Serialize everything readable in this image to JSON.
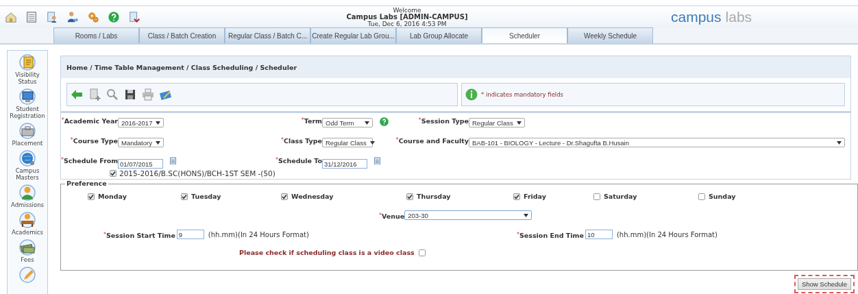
{
  "header": {
    "welcome": "Welcome",
    "user": "Campus Labs [ADMIN-CAMPUS]",
    "datetime": "Tue, Dec 6, 2016 4:53 PM",
    "logo_primary": "campus",
    "logo_secondary": "labs"
  },
  "tabs": [
    {
      "label": "Rooms / Labs",
      "selected": false
    },
    {
      "label": "Class / Batch Creation",
      "selected": false
    },
    {
      "label": "Regular Class / Batch C...",
      "selected": false
    },
    {
      "label": "Create Regular Lab Grou...",
      "selected": false
    },
    {
      "label": "Lab Group Allocate",
      "selected": false
    },
    {
      "label": "Scheduler",
      "selected": true
    },
    {
      "label": "Weekly Schedule",
      "selected": false
    }
  ],
  "sidebar": {
    "items": [
      {
        "label": "Visibility Status"
      },
      {
        "label": "Student Registration"
      },
      {
        "label": "Placement"
      },
      {
        "label": "Campus Masters"
      },
      {
        "label": "Admissions"
      },
      {
        "label": "Academics"
      },
      {
        "label": "Fees"
      }
    ]
  },
  "breadcrumb": "Home / Time Table Management / Class Scheduling / Scheduler",
  "mandatory_note": "* indicates mandatory fields",
  "form": {
    "rows": [
      [
        {
          "mark": "*",
          "label": "Academic Year",
          "kind": "select",
          "value": "2016-2017"
        },
        {
          "mark": "*",
          "label": "Term",
          "kind": "select",
          "value": "Odd Term",
          "help": true
        },
        {
          "mark": "*",
          "label": "Session Type",
          "kind": "select",
          "value": "Regular Class"
        }
      ],
      [
        {
          "mark": "*",
          "label": "Course Type",
          "kind": "select",
          "value": "Mandatory"
        },
        {
          "mark": "*",
          "label": "Class Type",
          "kind": "select",
          "value": "Regular Class"
        },
        {
          "mark": "*",
          "label": "Course and Faculty",
          "kind": "select",
          "value": "BAB-101 - BIOLOGY - Lecture - Dr.Shagufta B.Husain"
        }
      ],
      [
        {
          "mark": "*",
          "label": "Schedule From",
          "kind": "date",
          "value": "01/07/2015"
        },
        {
          "mark": "*",
          "label": "Schedule To",
          "kind": "date",
          "value": "31/12/2016"
        }
      ]
    ],
    "batch": {
      "label": "2015-2016/B.SC(HONS)/BCH-1ST SEM -(50)",
      "checked": true
    }
  },
  "preference": {
    "legend": "Preference",
    "days": [
      {
        "label": "Monday",
        "checked": true
      },
      {
        "label": "Tuesday",
        "checked": true
      },
      {
        "label": "Wednesday",
        "checked": true
      },
      {
        "label": "Thursday",
        "checked": true
      },
      {
        "label": "Friday",
        "checked": true
      },
      {
        "label": "Saturday",
        "checked": false
      },
      {
        "label": "Sunday",
        "checked": false
      }
    ],
    "venue": {
      "mark": "*",
      "label": "Venue",
      "value": "203-30"
    },
    "start": {
      "mark": "*",
      "label": "Session Start Time",
      "value": "9",
      "hint": "(hh.mm)(In 24 Hours Format)"
    },
    "end": {
      "mark": "*",
      "label": "Session End Time",
      "value": "10",
      "hint": "(hh.mm)(In 24 Hours Format)"
    },
    "video": {
      "label": "Please check if scheduling class is a video class",
      "checked": false
    }
  },
  "show_button": {
    "label": "Show Schedule",
    "highlighted": true
  }
}
